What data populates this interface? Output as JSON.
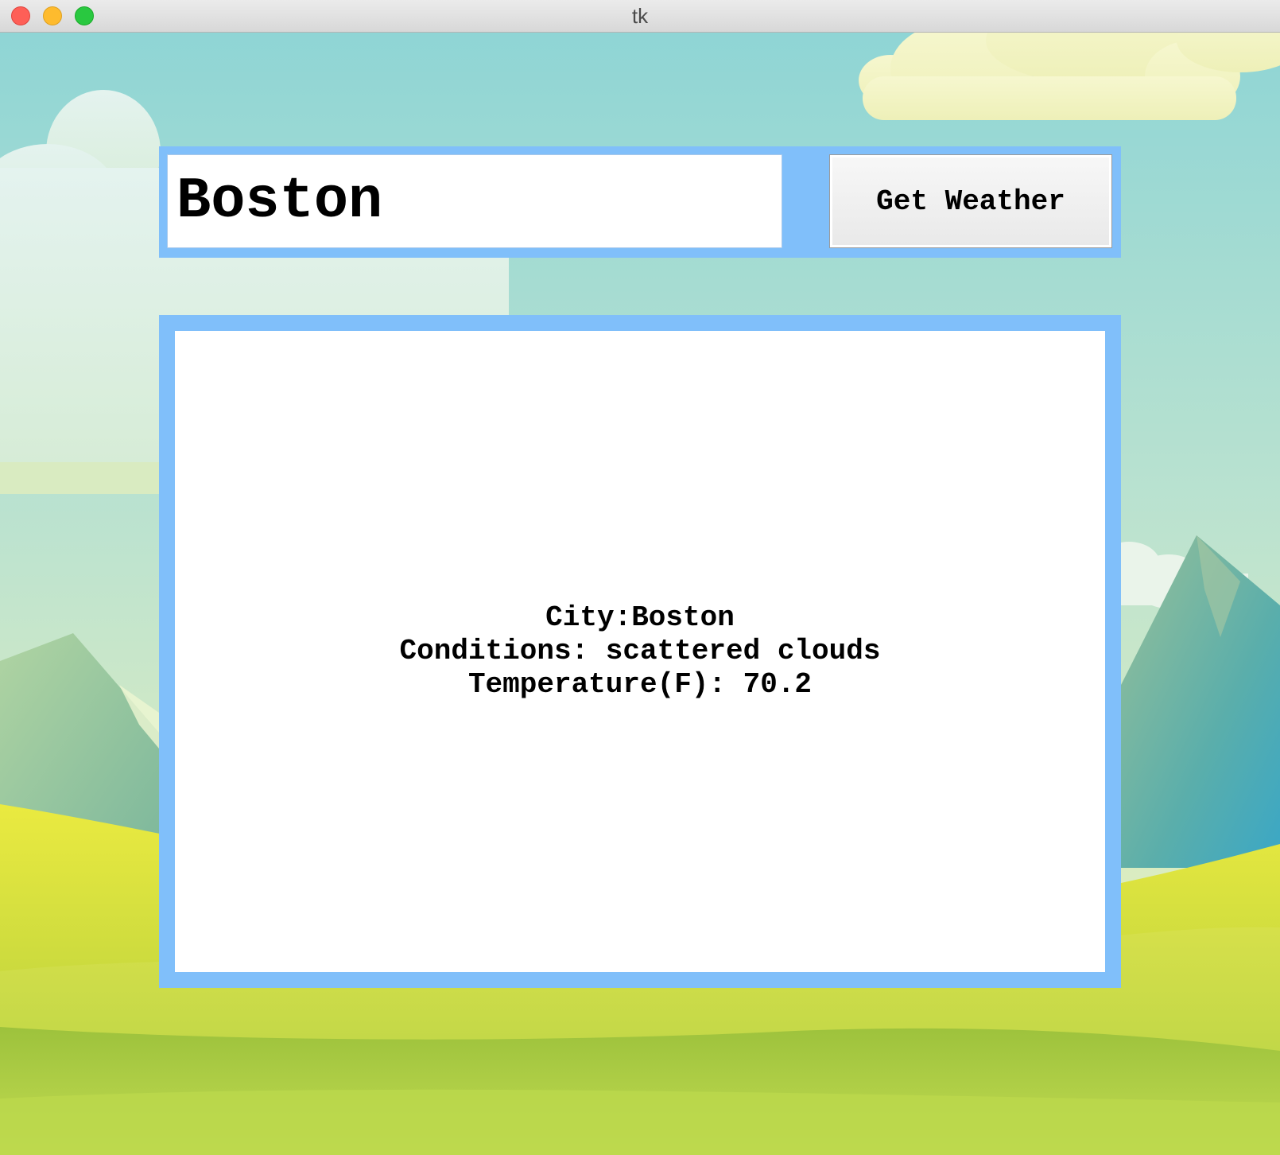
{
  "window": {
    "title": "tk"
  },
  "search": {
    "value": "Boston",
    "button_label": "Get Weather"
  },
  "result": {
    "city_line": "City:Boston",
    "conditions_line": "Conditions: scattered clouds",
    "temperature_line": "Temperature(F): 70.2"
  },
  "colors": {
    "panel_border": "#80bffa",
    "panel_background": "#ffffff",
    "sky_top": "#8fd5d5",
    "grass": "#b6d243",
    "mountain": "#5fae9f"
  }
}
